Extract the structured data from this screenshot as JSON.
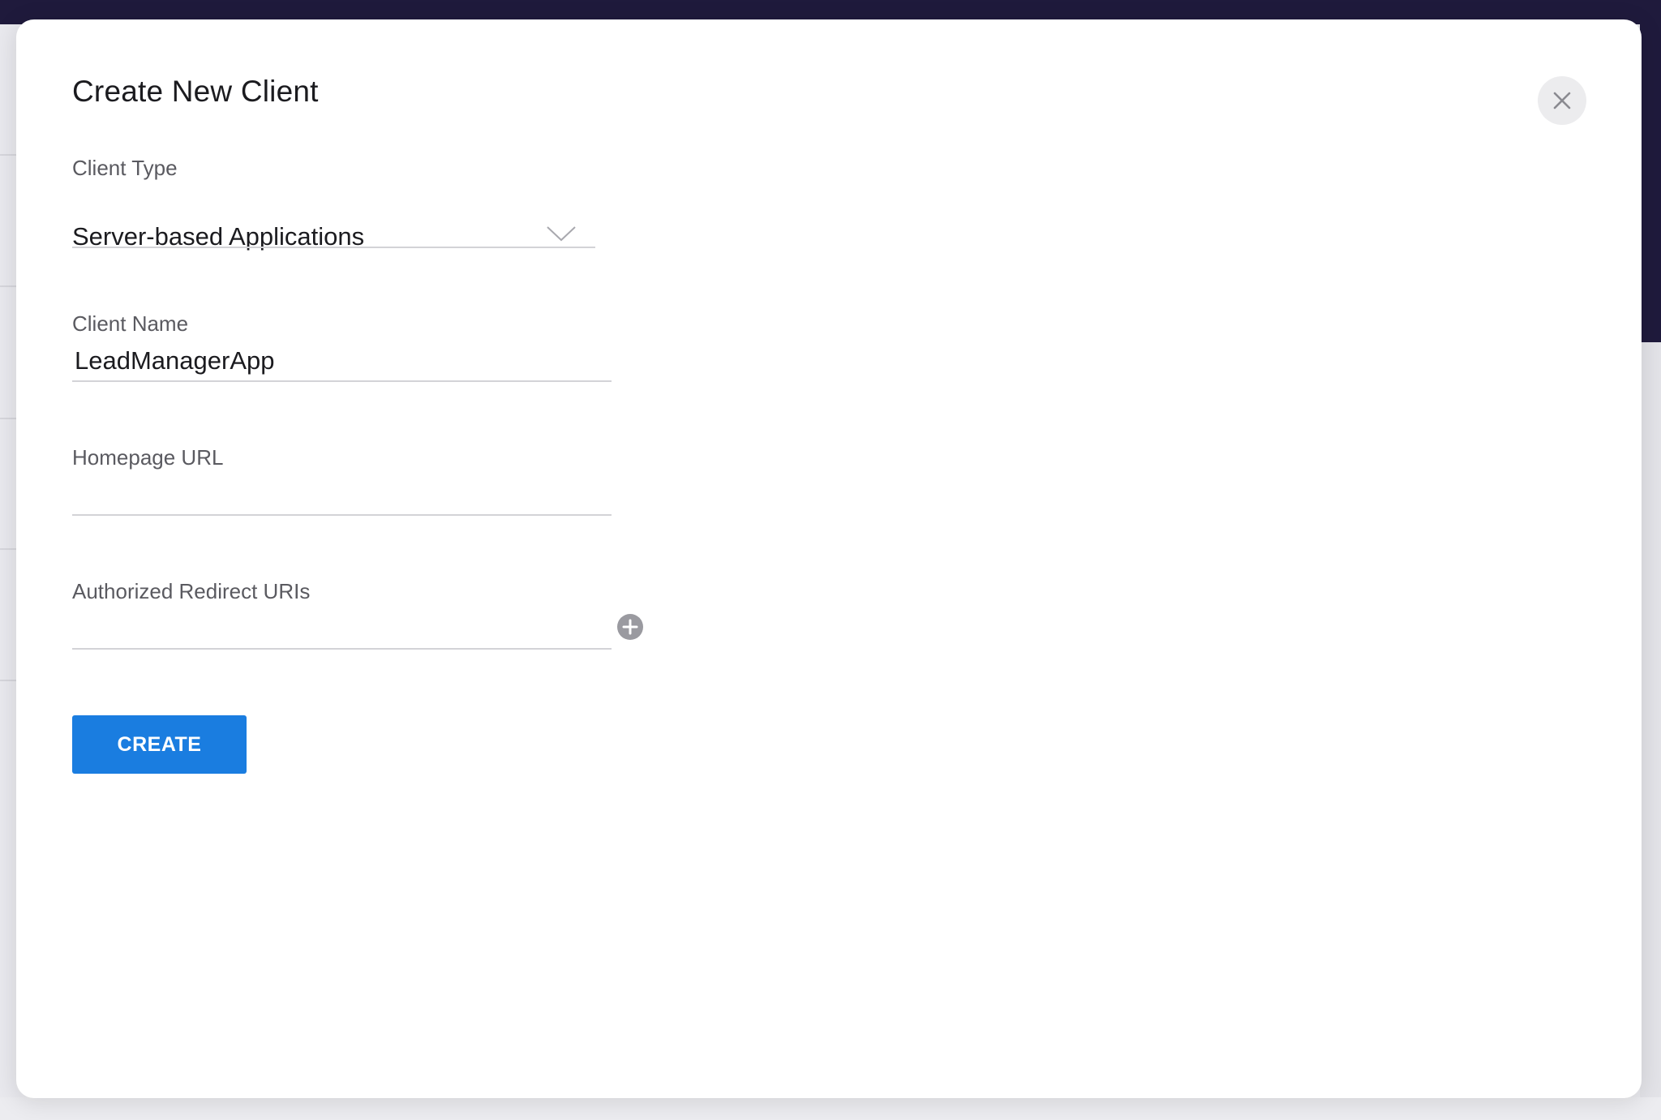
{
  "modal": {
    "title": "Create New Client"
  },
  "form": {
    "client_type": {
      "label": "Client Type",
      "selected": "Server-based Applications"
    },
    "client_name": {
      "label": "Client Name",
      "value": "LeadManagerApp",
      "placeholder": ""
    },
    "homepage_url": {
      "label": "Homepage URL",
      "value": "",
      "placeholder": ""
    },
    "redirect_uris": {
      "label": "Authorized Redirect URIs",
      "value": "",
      "placeholder": ""
    },
    "submit_label": "CREATE"
  },
  "icons": {
    "close": "close-icon",
    "dropdown": "chevron-down-icon",
    "add": "plus-circle-icon"
  },
  "colors": {
    "primary": "#1a7de0",
    "backdrop": "#1f1a3c",
    "input_line": "#d3d3d7",
    "label": "#5a5a60",
    "add_icon": "#9a9aa0"
  }
}
